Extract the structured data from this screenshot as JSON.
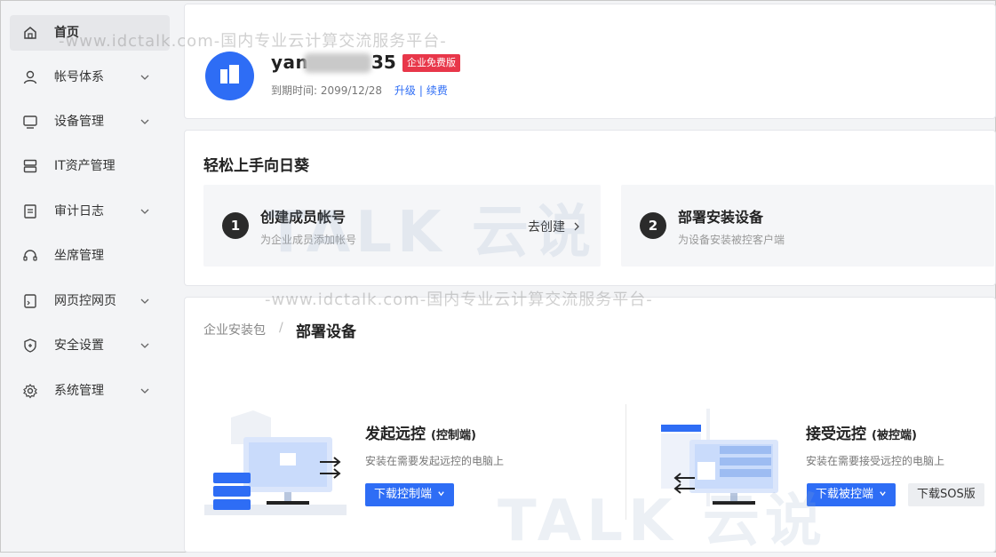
{
  "sidebar": {
    "items": [
      {
        "label": "首页",
        "icon": "home-icon",
        "active": true,
        "expandable": false
      },
      {
        "label": "帐号体系",
        "icon": "user-icon",
        "active": false,
        "expandable": true
      },
      {
        "label": "设备管理",
        "icon": "monitor-icon",
        "active": false,
        "expandable": true
      },
      {
        "label": "IT资产管理",
        "icon": "server-icon",
        "active": false,
        "expandable": false
      },
      {
        "label": "审计日志",
        "icon": "document-icon",
        "active": false,
        "expandable": true
      },
      {
        "label": "坐席管理",
        "icon": "headset-icon",
        "active": false,
        "expandable": false
      },
      {
        "label": "网页控网页",
        "icon": "webpage-icon",
        "active": false,
        "expandable": true
      },
      {
        "label": "安全设置",
        "icon": "shield-icon",
        "active": false,
        "expandable": true
      },
      {
        "label": "系统管理",
        "icon": "gear-icon",
        "active": false,
        "expandable": true
      }
    ]
  },
  "account": {
    "name_prefix": "yan",
    "name_suffix": "35",
    "badge": "企业免费版",
    "expire_label": "到期时间: 2099/12/28",
    "upgrade": "升级",
    "separator": "|",
    "renew": "续费"
  },
  "onboarding": {
    "title": "轻松上手向日葵",
    "steps": [
      {
        "num": "1",
        "title": "创建成员帐号",
        "sub": "为企业成员添加帐号",
        "action": "去创建"
      },
      {
        "num": "2",
        "title": "部署安装设备",
        "sub": "为设备安装被控客户端"
      }
    ]
  },
  "deploy": {
    "breadcrumb_parent": "企业安装包",
    "breadcrumb_sep": "/",
    "breadcrumb_current": "部署设备",
    "controller": {
      "title": "发起远控",
      "tag": "(控制端)",
      "sub": "安装在需要发起远控的电脑上",
      "button": "下载控制端"
    },
    "host": {
      "title": "接受远控",
      "tag": "(被控端)",
      "sub": "安装在需要接受远控的电脑上",
      "button": "下载被控端",
      "button2": "下载SOS版"
    }
  },
  "watermark": {
    "text": "-www.idctalk.com-国内专业云计算交流服务平台-",
    "logo": "TALK 云说"
  },
  "colors": {
    "accent": "#2e6df5",
    "badge": "#e8374a",
    "sidebar_bg": "#f3f4f6"
  }
}
